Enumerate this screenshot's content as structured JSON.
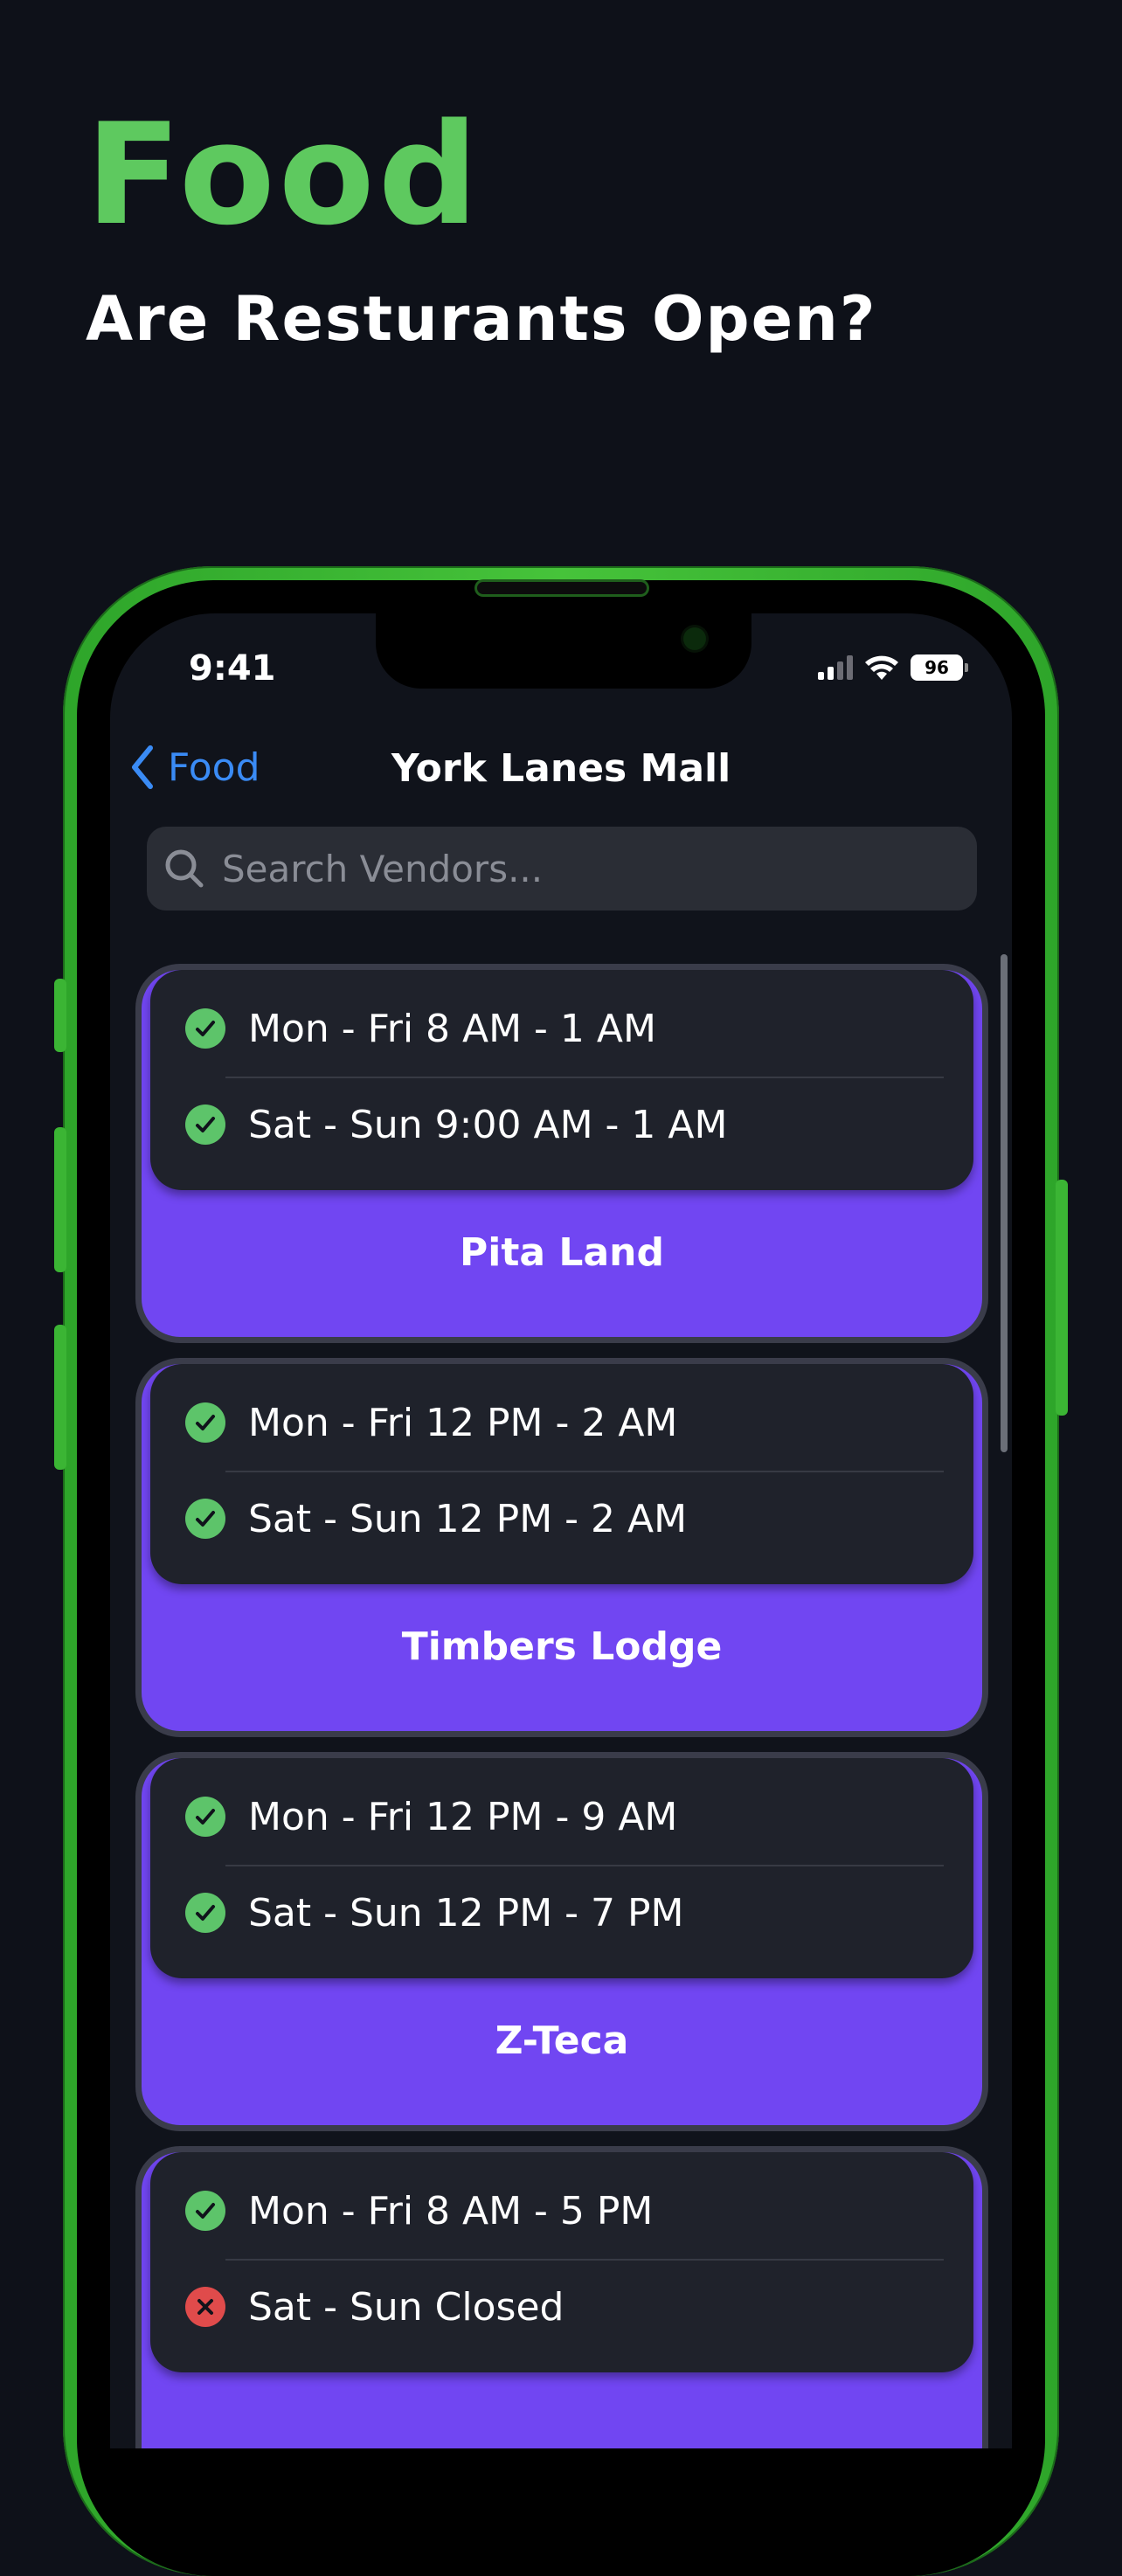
{
  "hero": {
    "title": "Food",
    "subtitle": "Are Resturants Open?"
  },
  "status_bar": {
    "time": "9:41",
    "battery": "96"
  },
  "nav": {
    "back_label": "Food",
    "title": "York Lanes Mall"
  },
  "search": {
    "placeholder": "Search Vendors..."
  },
  "vendors": [
    {
      "name": "Pita Land",
      "hours": [
        {
          "text": "Mon - Fri 8 AM - 1 AM",
          "status": "open"
        },
        {
          "text": "Sat - Sun 9:00 AM - 1 AM",
          "status": "open"
        }
      ]
    },
    {
      "name": "Timbers Lodge",
      "hours": [
        {
          "text": "Mon - Fri 12 PM - 2 AM",
          "status": "open"
        },
        {
          "text": "Sat - Sun 12 PM - 2 AM",
          "status": "open"
        }
      ]
    },
    {
      "name": "Z-Teca",
      "hours": [
        {
          "text": "Mon - Fri 12 PM - 9 AM",
          "status": "open"
        },
        {
          "text": "Sat - Sun 12 PM - 7 PM",
          "status": "open"
        }
      ]
    },
    {
      "name": "",
      "hours": [
        {
          "text": "Mon - Fri 8 AM - 5 PM",
          "status": "open"
        },
        {
          "text": "Sat - Sun Closed",
          "status": "closed"
        }
      ]
    }
  ],
  "colors": {
    "accent_green": "#5ec95f",
    "card_purple": "#7146f2",
    "link_blue": "#3a8bf5",
    "open_green": "#5dc46a",
    "closed_red": "#e04b4b"
  },
  "icons": {
    "back": "chevron-left-icon",
    "search": "magnifier-icon",
    "open": "checkmark-circle-icon",
    "closed": "x-circle-icon"
  }
}
